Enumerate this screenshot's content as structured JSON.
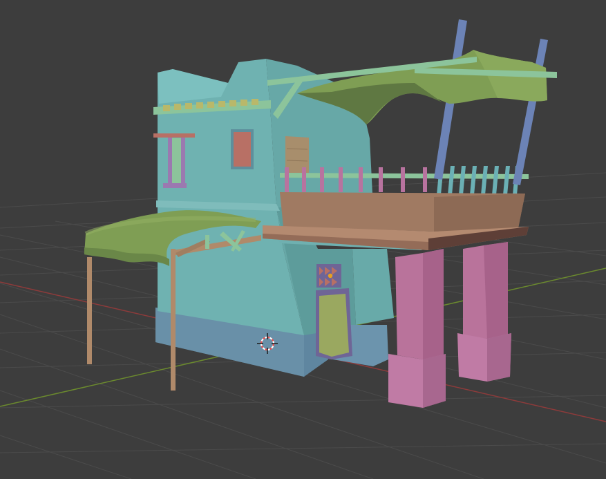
{
  "viewport": {
    "background": "#3d3d3d",
    "grid_color": "#4a4a4a",
    "x_axis_color": "#8e3b3b",
    "y_axis_color": "#6b8a2e"
  },
  "scene": {
    "object": "house-model",
    "colors": {
      "wall": "#6fb2b1",
      "wall_shadow": "#5d9c9b",
      "base": "#6c94ad",
      "trim_green": "#8cc49b",
      "awning_green": "#7f9e54",
      "awning_dark": "#5f7842",
      "pillar_pink": "#b9739b",
      "balcony_brown": "#a07a62",
      "rail_pink": "#b8739f",
      "rail_teal": "#6bb0b5",
      "pole_blue": "#6c83b6",
      "pole_tan": "#b08a6a",
      "door_green": "#9aa860",
      "window_pink": "#b87065"
    }
  },
  "gizmo": {
    "icon": "3d-cursor-icon",
    "origin_color": "#e8a020"
  }
}
